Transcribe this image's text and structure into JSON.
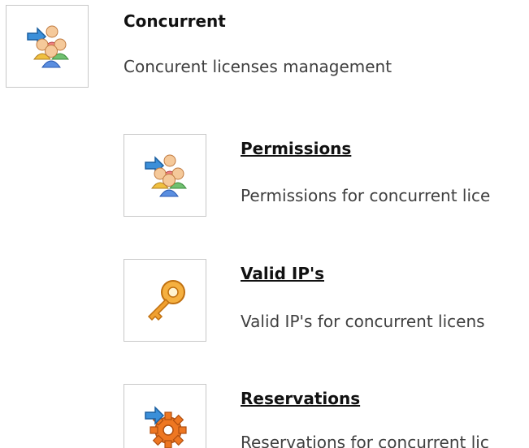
{
  "header": {
    "title": "Concurrent",
    "description": "Concurent licenses management",
    "icon": "users-arrow-icon"
  },
  "items": [
    {
      "title": "Permissions",
      "description": "Permissions for concurrent lice",
      "icon": "users-arrow-icon"
    },
    {
      "title": "Valid IP's",
      "description": "Valid IP's for concurrent licens",
      "icon": "key-icon"
    },
    {
      "title": "Reservations",
      "description": "Reservations for concurrent lic",
      "icon": "gear-arrow-icon"
    }
  ],
  "colors": {
    "border": "#c8c8c8",
    "arrow": "#3b8fd9",
    "key": "#f0a030",
    "gear": "#ee7722"
  }
}
